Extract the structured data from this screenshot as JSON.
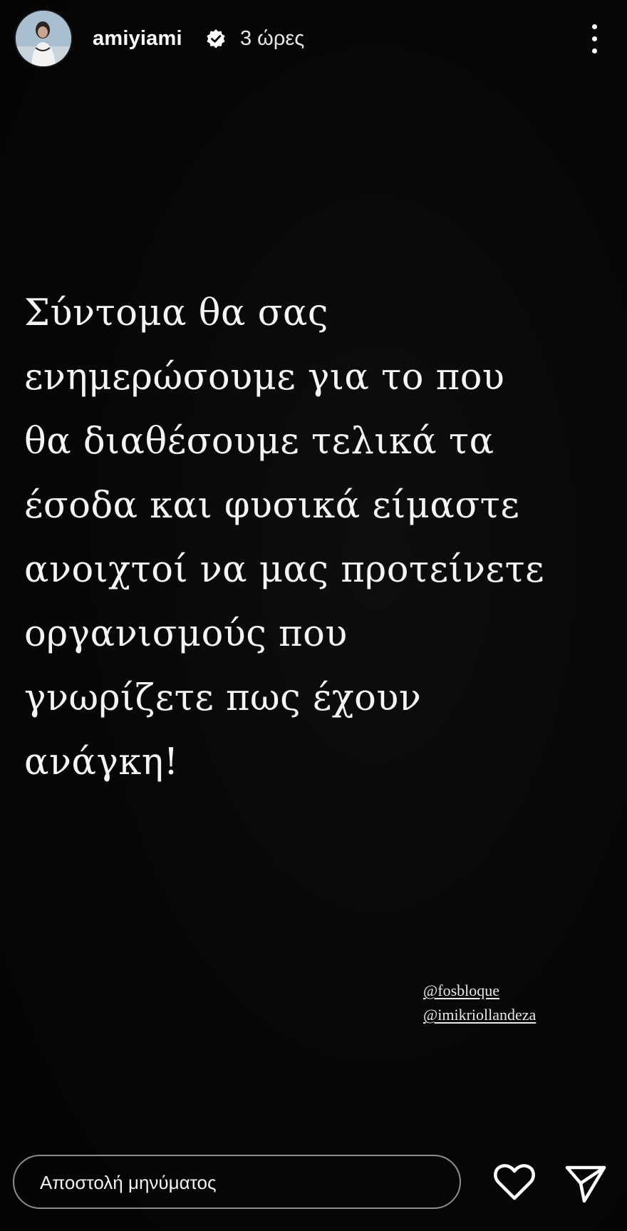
{
  "header": {
    "username": "amiyiami",
    "verified": true,
    "time": "3 ώρες",
    "more_icon": "more-vertical-icon"
  },
  "story": {
    "lines": [
      "Σύντομα θα σας",
      "ενημερώσουμε για το που",
      "θα διαθέσουμε τελικά τα",
      "έσοδα και φυσικά είμαστε",
      "ανοιχτοί να μας προτείνετε",
      "οργανισμούς που",
      "γνωρίζετε πως έχουν",
      "ανάγκη!"
    ],
    "mentions": [
      "@fosbloque",
      "@imikriollandeza"
    ]
  },
  "footer": {
    "message_placeholder": "Αποστολή μηνύματος",
    "like_icon": "heart-icon",
    "send_icon": "send-icon"
  },
  "colors": {
    "background": "#050505",
    "text": "#ffffff",
    "input_border": "#8d8d8d"
  }
}
